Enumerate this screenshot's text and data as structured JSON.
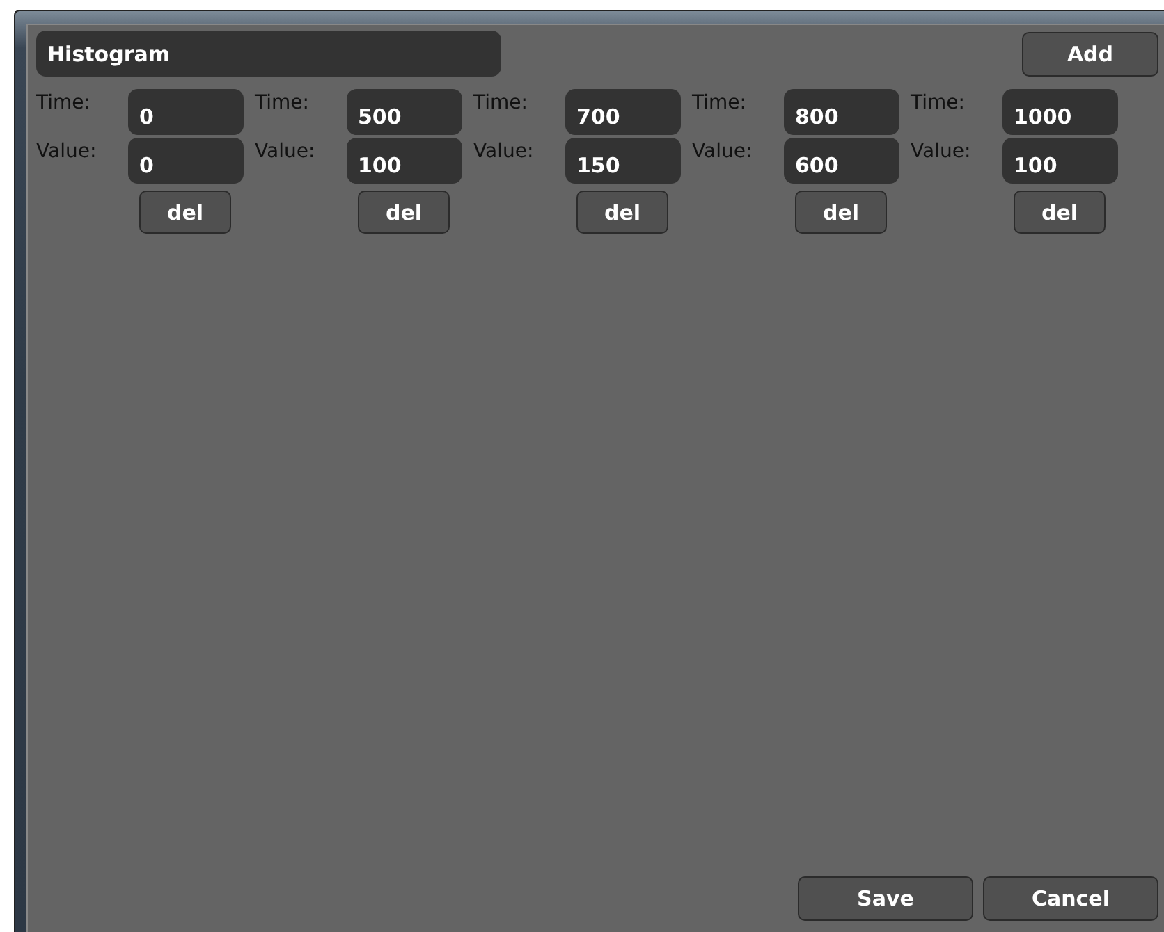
{
  "name_field": {
    "value": "Histogram"
  },
  "add_button": "Add",
  "points": [
    {
      "time_label": "Time:",
      "time": "0",
      "value_label": "Value:",
      "value": "0",
      "delete": "del"
    },
    {
      "time_label": "Time:",
      "time": "500",
      "value_label": "Value:",
      "value": "100",
      "delete": "del"
    },
    {
      "time_label": "Time:",
      "time": "700",
      "value_label": "Value:",
      "value": "150",
      "delete": "del"
    },
    {
      "time_label": "Time:",
      "time": "800",
      "value_label": "Value:",
      "value": "600",
      "delete": "del"
    },
    {
      "time_label": "Time:",
      "time": "1000",
      "value_label": "Value:",
      "value": "100",
      "delete": "del"
    }
  ],
  "buttons": [
    "Save",
    "Cancel"
  ]
}
